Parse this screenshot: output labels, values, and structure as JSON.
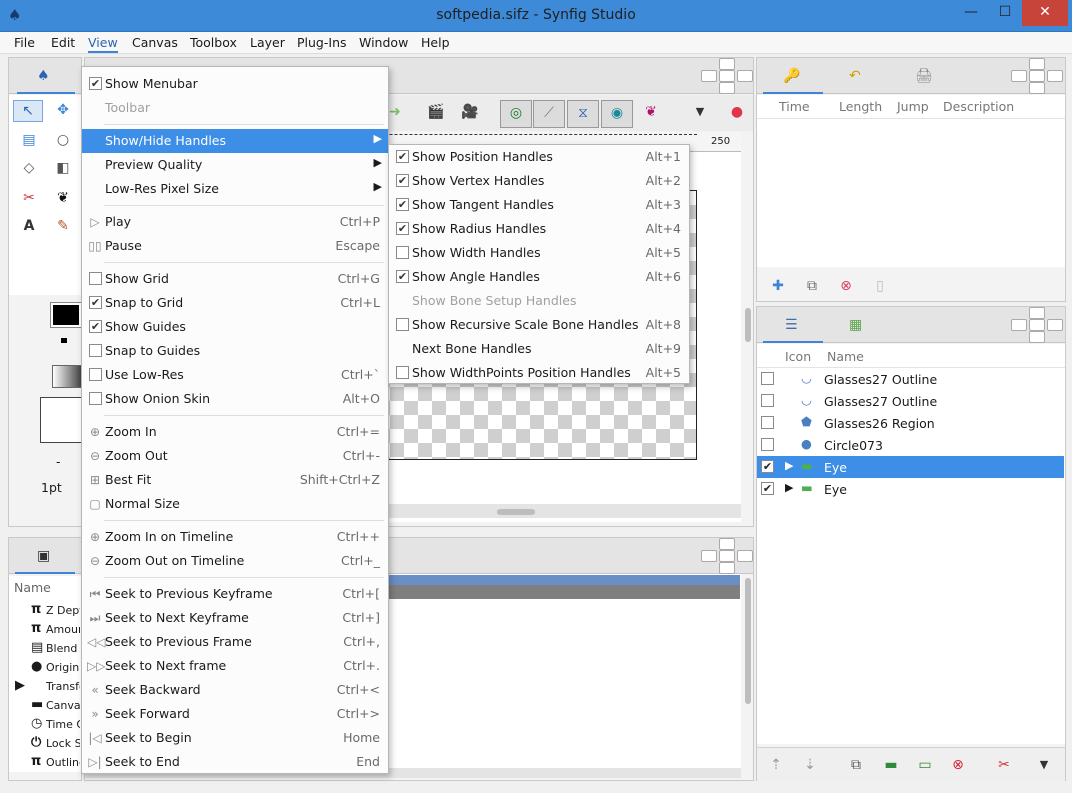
{
  "window": {
    "title": "softpedia.sifz - Synfig Studio",
    "controls": [
      "—",
      "☐",
      "✕"
    ]
  },
  "menubar": [
    "File",
    "Edit",
    "View",
    "Canvas",
    "Toolbox",
    "Layer",
    "Plug-Ins",
    "Window",
    "Help"
  ],
  "view_menu": {
    "items": [
      {
        "type": "check",
        "label": "Show Menubar",
        "checked": true,
        "shortcut": ""
      },
      {
        "type": "plain",
        "label": "Toolbar",
        "disabled": true,
        "shortcut": ""
      },
      {
        "type": "sep"
      },
      {
        "type": "submenu",
        "label": "Show/Hide Handles",
        "highlighted": true
      },
      {
        "type": "submenu",
        "label": "Preview Quality"
      },
      {
        "type": "submenu",
        "label": "Low-Res Pixel Size"
      },
      {
        "type": "sep"
      },
      {
        "type": "icon",
        "icon": "▷",
        "label": "Play",
        "shortcut": "Ctrl+P"
      },
      {
        "type": "icon",
        "icon": "▯▯",
        "label": "Pause",
        "shortcut": "Escape"
      },
      {
        "type": "sep"
      },
      {
        "type": "check",
        "label": "Show Grid",
        "checked": false,
        "shortcut": "Ctrl+G"
      },
      {
        "type": "check",
        "label": "Snap to Grid",
        "checked": true,
        "shortcut": "Ctrl+L"
      },
      {
        "type": "check",
        "label": "Show Guides",
        "checked": true,
        "shortcut": ""
      },
      {
        "type": "check",
        "label": "Snap to Guides",
        "checked": false,
        "shortcut": ""
      },
      {
        "type": "check",
        "label": "Use Low-Res",
        "checked": false,
        "shortcut": "Ctrl+`"
      },
      {
        "type": "check",
        "label": "Show Onion Skin",
        "checked": false,
        "shortcut": "Alt+O"
      },
      {
        "type": "sep"
      },
      {
        "type": "icon",
        "icon": "⊕",
        "label": "Zoom In",
        "shortcut": "Ctrl+="
      },
      {
        "type": "icon",
        "icon": "⊖",
        "label": "Zoom Out",
        "shortcut": "Ctrl+-"
      },
      {
        "type": "icon",
        "icon": "⊞",
        "label": "Best Fit",
        "shortcut": "Shift+Ctrl+Z"
      },
      {
        "type": "icon",
        "icon": "▢",
        "label": "Normal Size",
        "shortcut": ""
      },
      {
        "type": "sep"
      },
      {
        "type": "icon",
        "icon": "⊕",
        "label": "Zoom In on Timeline",
        "shortcut": "Ctrl++"
      },
      {
        "type": "icon",
        "icon": "⊖",
        "label": "Zoom Out on Timeline",
        "shortcut": "Ctrl+_"
      },
      {
        "type": "sep"
      },
      {
        "type": "icon",
        "icon": "⏮",
        "label": "Seek to Previous Keyframe",
        "shortcut": "Ctrl+["
      },
      {
        "type": "icon",
        "icon": "⏭",
        "label": "Seek to Next Keyframe",
        "shortcut": "Ctrl+]"
      },
      {
        "type": "icon",
        "icon": "◁◁",
        "label": "Seek to Previous Frame",
        "shortcut": "Ctrl+,"
      },
      {
        "type": "icon",
        "icon": "▷▷",
        "label": "Seek to Next frame",
        "shortcut": "Ctrl+."
      },
      {
        "type": "icon",
        "icon": "«",
        "label": "Seek Backward",
        "shortcut": "Ctrl+<"
      },
      {
        "type": "icon",
        "icon": "»",
        "label": "Seek Forward",
        "shortcut": "Ctrl+>"
      },
      {
        "type": "icon",
        "icon": "|◁",
        "label": "Seek to Begin",
        "shortcut": "Home"
      },
      {
        "type": "icon",
        "icon": "▷|",
        "label": "Seek to End",
        "shortcut": "End"
      }
    ]
  },
  "handles_menu": {
    "items": [
      {
        "type": "check",
        "label": "Show Position Handles",
        "checked": true,
        "shortcut": "Alt+1"
      },
      {
        "type": "check",
        "label": "Show Vertex Handles",
        "checked": true,
        "shortcut": "Alt+2"
      },
      {
        "type": "check",
        "label": "Show Tangent Handles",
        "checked": true,
        "shortcut": "Alt+3"
      },
      {
        "type": "check",
        "label": "Show Radius Handles",
        "checked": true,
        "shortcut": "Alt+4"
      },
      {
        "type": "check",
        "label": "Show Width Handles",
        "checked": false,
        "shortcut": "Alt+5"
      },
      {
        "type": "check",
        "label": "Show Angle Handles",
        "checked": true,
        "shortcut": "Alt+6"
      },
      {
        "type": "plain",
        "label": "Show Bone Setup Handles",
        "disabled": true,
        "shortcut": ""
      },
      {
        "type": "check",
        "label": "Show Recursive Scale Bone Handles",
        "checked": false,
        "shortcut": "Alt+8"
      },
      {
        "type": "plain",
        "label": "Next Bone Handles",
        "disabled": false,
        "shortcut": "Alt+9"
      },
      {
        "type": "check",
        "label": "Show WidthPoints Position Handles",
        "checked": false,
        "shortcut": "Alt+5"
      }
    ]
  },
  "ruler": {
    "mark": "250"
  },
  "toolbox": {
    "brush_size": "1pt",
    "dash": "-"
  },
  "keyframes_panel": {
    "columns": [
      "Time",
      "Length",
      "Jump",
      "Description"
    ]
  },
  "layers_panel": {
    "columns": [
      "Icon",
      "Name"
    ],
    "rows": [
      {
        "name": "Glasses27 Outline",
        "checked": false,
        "icon": "outline-icon",
        "selected": false,
        "expander": false
      },
      {
        "name": "Glasses27 Outline",
        "checked": false,
        "icon": "outline-icon",
        "selected": false,
        "expander": false
      },
      {
        "name": "Glasses26 Region",
        "checked": false,
        "icon": "region-icon",
        "selected": false,
        "expander": false
      },
      {
        "name": "Circle073",
        "checked": false,
        "icon": "circle-icon",
        "selected": false,
        "expander": false
      },
      {
        "name": "Eye",
        "checked": true,
        "icon": "folder-icon",
        "selected": true,
        "expander": true
      },
      {
        "name": "Eye",
        "checked": true,
        "icon": "folder-icon",
        "selected": false,
        "expander": true
      }
    ]
  },
  "params_panel": {
    "header": "Name",
    "rows": [
      {
        "icon": "π",
        "label": "Z Depth"
      },
      {
        "icon": "π",
        "label": "Amount"
      },
      {
        "icon": "▤",
        "label": "Blend M"
      },
      {
        "icon": "●",
        "label": "Origin"
      },
      {
        "icon": "▶",
        "label": "Transfo"
      },
      {
        "icon": "▬",
        "label": "Canvas"
      },
      {
        "icon": "◷",
        "label": "Time Of"
      },
      {
        "icon": "⏻",
        "label": "Lock Se"
      },
      {
        "icon": "π",
        "label": "Outline"
      }
    ]
  },
  "colors": {
    "titlebar": "#3c8ad8",
    "highlight": "#3d8ee6",
    "accent": "#3d84d6",
    "close": "#c7443b"
  }
}
